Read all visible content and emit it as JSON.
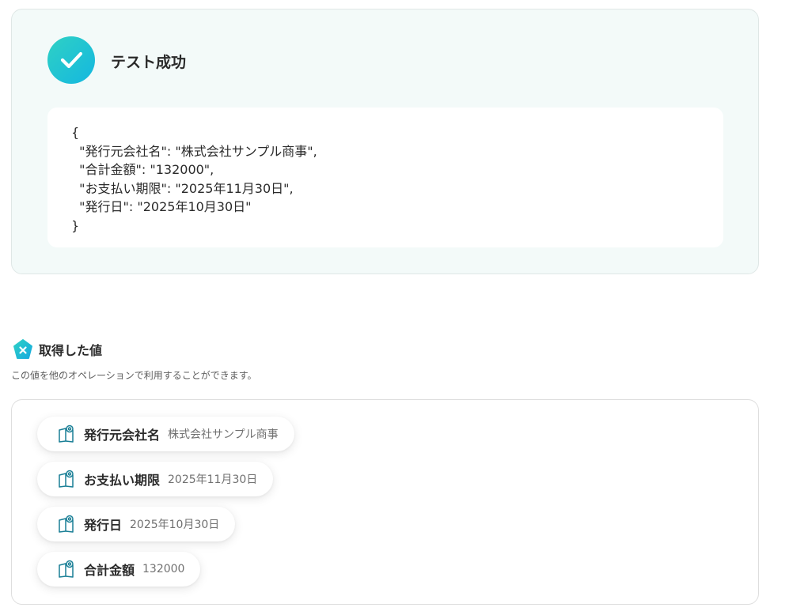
{
  "test_result": {
    "title": "テスト成功",
    "json_lines": [
      "{",
      "  \"発行元会社名\": \"株式会社サンプル商事\",",
      "  \"合計金額\": \"132000\",",
      "  \"お支払い期限\": \"2025年11月30日\",",
      "  \"発行日\": \"2025年10月30日\"",
      "}"
    ]
  },
  "acquired_values": {
    "title": "取得した値",
    "description": "この値を他のオペレーションで利用することができます。",
    "items": [
      {
        "key": "発行元会社名",
        "value": "株式会社サンプル商事"
      },
      {
        "key": "お支払い期限",
        "value": "2025年11月30日"
      },
      {
        "key": "発行日",
        "value": "2025年10月30日"
      },
      {
        "key": "合計金額",
        "value": "132000"
      }
    ]
  },
  "icons": {
    "success": "check-icon",
    "values_header": "variable-x-icon",
    "chip": "output-value-icon"
  },
  "colors": {
    "accent_teal": "#2fd1c4",
    "accent_blue": "#14b7e0",
    "panel_bg": "#f3faf9",
    "chip_icon": "#1a7f96"
  }
}
